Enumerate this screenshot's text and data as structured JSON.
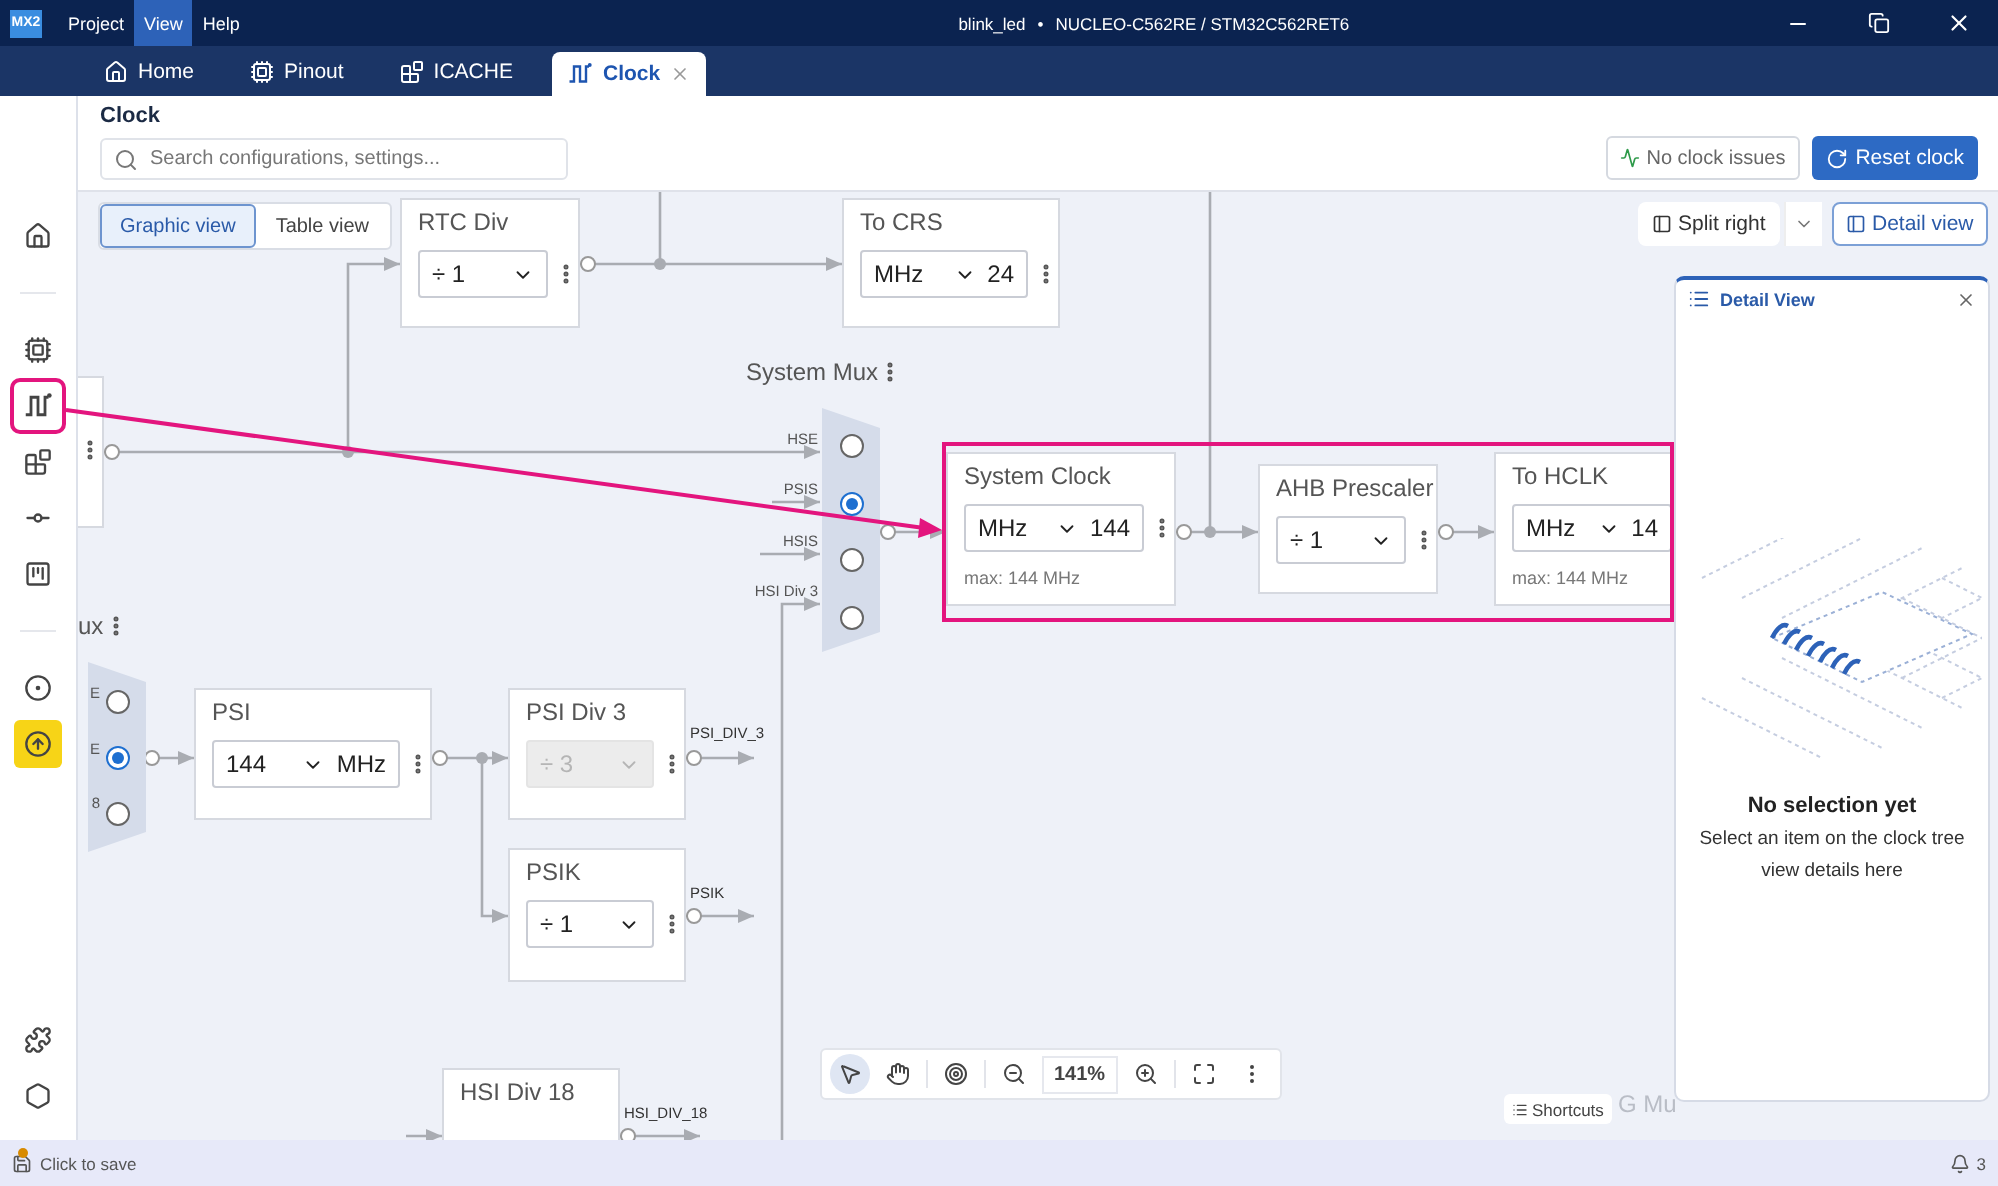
{
  "title_bar": {
    "logo": "MX2",
    "menus": [
      {
        "label": "Project",
        "selected": false
      },
      {
        "label": "View",
        "selected": true
      },
      {
        "label": "Help",
        "selected": false
      }
    ],
    "project": "blink_led",
    "separator": "•",
    "board": "NUCLEO-C562RE / STM32C562RET6"
  },
  "tabs": [
    {
      "kind": "home",
      "label": "Home",
      "selected": false,
      "closable": false
    },
    {
      "kind": "chip",
      "label": "Pinout",
      "selected": false,
      "closable": false
    },
    {
      "kind": "cache",
      "label": "ICACHE",
      "selected": false,
      "closable": false
    },
    {
      "kind": "clock",
      "label": "Clock",
      "selected": true,
      "closable": true
    }
  ],
  "header": {
    "title": "Clock",
    "search_placeholder": "Search configurations, settings...",
    "status": "No clock issues",
    "reset": "Reset clock"
  },
  "sidebar": [
    {
      "kind": "home",
      "selected": false,
      "highlighted": false
    },
    {
      "kind": "divider"
    },
    {
      "kind": "chip",
      "selected": false,
      "highlighted": false
    },
    {
      "kind": "clock",
      "selected": true,
      "highlighted": false
    },
    {
      "kind": "cache",
      "selected": false,
      "highlighted": false
    },
    {
      "kind": "connect",
      "selected": false,
      "highlighted": false
    },
    {
      "kind": "board",
      "selected": false,
      "highlighted": false
    },
    {
      "kind": "divider"
    },
    {
      "kind": "target",
      "selected": false,
      "highlighted": false
    },
    {
      "kind": "upload",
      "selected": false,
      "highlighted": true
    },
    {
      "kind": "spacer"
    },
    {
      "kind": "puzzle",
      "selected": false,
      "highlighted": false
    },
    {
      "kind": "settings",
      "selected": false,
      "highlighted": false
    }
  ],
  "canvas": {
    "views": [
      {
        "label": "Graphic view",
        "selected": true
      },
      {
        "label": "Table view",
        "selected": false
      }
    ],
    "split": "Split right",
    "detail_button": "Detail view",
    "blocks": [
      {
        "title": "RTC Div",
        "select": "÷ 1",
        "disabled": false,
        "menu": true
      },
      {
        "title": "To CRS",
        "select": "MHz",
        "suffix": "24",
        "disabled": false,
        "menu": true
      },
      {
        "title": "System Clock",
        "select": "MHz",
        "suffix": "144",
        "note": "max: 144 MHz",
        "disabled": false,
        "menu": true
      },
      {
        "title": "AHB Prescaler",
        "select": "÷ 1",
        "disabled": false,
        "menu": true
      },
      {
        "title": "To HCLK",
        "select": "MHz",
        "suffix": "14",
        "note": "max: 144 MHz",
        "disabled": false,
        "menu": false
      },
      {
        "title": "PSI",
        "select": "144",
        "suffix": "MHz",
        "disabled": false,
        "menu": true
      },
      {
        "title": "PSI Div 3",
        "select": "÷ 3",
        "disabled": true,
        "menu": true
      },
      {
        "title": "PSIK",
        "select": "÷ 1",
        "disabled": false,
        "menu": true
      },
      {
        "title": "HSI Div 18"
      }
    ],
    "muxes": [
      {
        "title": "System Mux",
        "inputs": [
          {
            "label": "HSE",
            "selected": false
          },
          {
            "label": "PSIS",
            "selected": true
          },
          {
            "label": "HSIS",
            "selected": false
          },
          {
            "label": "HSI Div 3",
            "selected": false
          }
        ]
      },
      {
        "title": "ux",
        "inputs": [
          {
            "label": "E",
            "selected": false
          },
          {
            "label": "E",
            "selected": true
          },
          {
            "label": "8",
            "selected": false
          }
        ]
      }
    ],
    "signal_labels": [
      "PSI_DIV_3",
      "PSIK",
      "HSI_DIV_18"
    ],
    "tools": [
      {
        "kind": "pointer",
        "selected": true
      },
      {
        "kind": "hand",
        "selected": false
      },
      {
        "kind": "target",
        "selected": false
      },
      {
        "kind": "zoom_out",
        "selected": false
      },
      {
        "kind": "zoom_in",
        "selected": false
      },
      {
        "kind": "fit",
        "selected": false
      },
      {
        "kind": "more",
        "selected": false
      }
    ],
    "zoom": "141%",
    "shortcuts": "Shortcuts",
    "faded_label": "G Mu"
  },
  "detail_panel": {
    "title": "Detail View",
    "empty_title": "No selection yet",
    "empty_lines": [
      "Select an item on the clock tree",
      "view details here"
    ]
  },
  "status_bar": {
    "save": "Click to save",
    "unsaved": true,
    "notifications": "3"
  }
}
